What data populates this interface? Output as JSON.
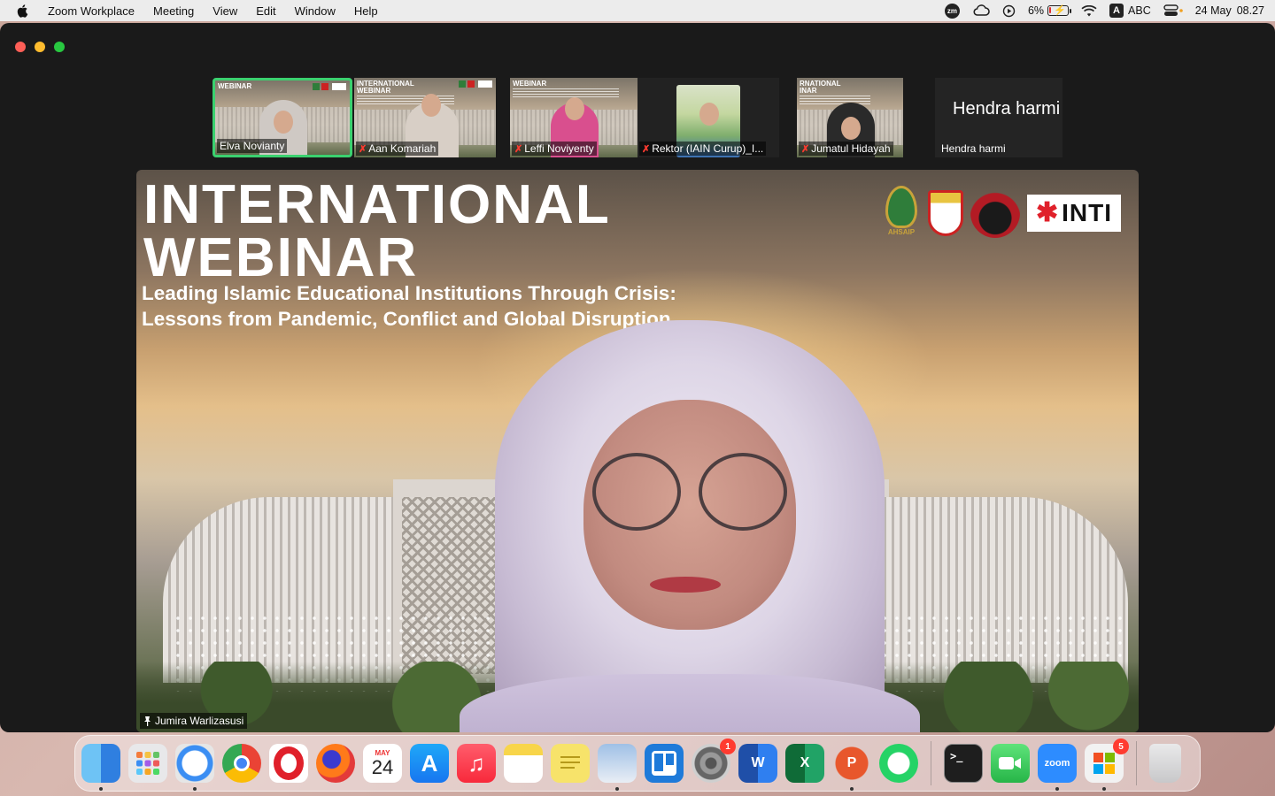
{
  "menubar": {
    "app_name": "Zoom Workplace",
    "menus": [
      "Meeting",
      "View",
      "Edit",
      "Window",
      "Help"
    ],
    "zm_label": "zm",
    "battery_percent": "6%",
    "battery_level": 0.06,
    "input_source": "ABC",
    "input_letter": "A",
    "date": "24 May",
    "time": "08.27"
  },
  "thumbnails": [
    {
      "name": "Elva Novianty",
      "mini_title": "WEBINAR",
      "muted": false,
      "active": true
    },
    {
      "name": "Aan Komariah",
      "mini_title": "INTERNATIONAL\nWEBINAR",
      "muted": true,
      "active": false
    },
    {
      "name": "Leffi Noviyenty",
      "mini_title": "WEBINAR",
      "muted": true,
      "active": false
    },
    {
      "name": "Rektor (IAIN Curup)_I...",
      "mini_title": "",
      "muted": true,
      "active": false
    },
    {
      "name": "Jumatul Hidayah",
      "mini_title": "RNATIONAL\nINAR",
      "muted": true,
      "active": false
    },
    {
      "name": "Hendra harmi",
      "big_name": "Hendra harmi",
      "muted": false,
      "active": false
    }
  ],
  "main_video": {
    "title_line1": "INTERNATIONAL",
    "title_line2": "WEBINAR",
    "subtitle_line1": "Leading Islamic Educational Institutions Through Crisis:",
    "subtitle_line2": "Lessons from Pandemic, Conflict and Global Disruption",
    "logo_ahsaip": "AHSAIP",
    "logo_inti": "INTI",
    "speaker_name": "Jumira Warlizasusi"
  },
  "dock": {
    "apps": [
      {
        "name": "Finder",
        "icon": "finder-icon"
      },
      {
        "name": "Launchpad",
        "icon": "launchpad-icon"
      },
      {
        "name": "Safari",
        "icon": "safari-icon"
      },
      {
        "name": "Chrome",
        "icon": "chrome-icon"
      },
      {
        "name": "Opera",
        "icon": "opera-icon"
      },
      {
        "name": "Firefox",
        "icon": "firefox-icon"
      },
      {
        "name": "Calendar",
        "icon": "calendar-icon",
        "month": "MAY",
        "day": "24"
      },
      {
        "name": "App Store",
        "icon": "app-store-icon"
      },
      {
        "name": "Music",
        "icon": "music-icon"
      },
      {
        "name": "Notes",
        "icon": "notes-icon"
      },
      {
        "name": "Stickies",
        "icon": "stickies-icon"
      },
      {
        "name": "Preview",
        "icon": "preview-icon"
      },
      {
        "name": "Trello",
        "icon": "trello-icon"
      },
      {
        "name": "System Settings",
        "icon": "settings-icon",
        "badge": "1"
      },
      {
        "name": "Word",
        "icon": "word-icon",
        "letter": "W"
      },
      {
        "name": "Excel",
        "icon": "excel-icon",
        "letter": "X"
      },
      {
        "name": "PowerPoint",
        "icon": "powerpoint-icon",
        "letter": "P"
      },
      {
        "name": "WhatsApp",
        "icon": "whatsapp-icon"
      },
      {
        "name": "Terminal",
        "icon": "terminal-icon",
        "letter": ">_"
      },
      {
        "name": "FaceTime",
        "icon": "facetime-icon"
      },
      {
        "name": "Zoom",
        "icon": "zoom-icon",
        "letter": "zoom"
      },
      {
        "name": "Microsoft 365",
        "icon": "office-icon",
        "badge": "5"
      },
      {
        "name": "Trash",
        "icon": "trash-icon"
      }
    ]
  }
}
